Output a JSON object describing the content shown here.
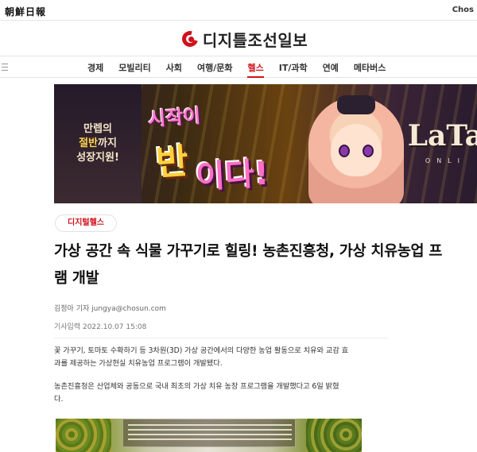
{
  "topbar": {
    "masthead": "朝鮮日報",
    "right_text": "Chos"
  },
  "logo": {
    "text": "디지틀조선일보",
    "accent": "#d1121b"
  },
  "nav": {
    "items": [
      {
        "label": "경제"
      },
      {
        "label": "모빌리티"
      },
      {
        "label": "사회"
      },
      {
        "label": "여행/문화"
      },
      {
        "label": "헬스",
        "active": true
      },
      {
        "label": "IT/과학"
      },
      {
        "label": "연예"
      },
      {
        "label": "메타버스"
      }
    ]
  },
  "banner": {
    "left_line1": "만렙의",
    "left_line2_highlight": "절반",
    "left_line2_rest": "까지",
    "left_line3": "성장지원!",
    "title_a": "시작이",
    "title_b": "반",
    "title_c": "이다!",
    "game_logo": "LaTa",
    "game_sub": "ONLI"
  },
  "article": {
    "category": "디지털헬스",
    "headline_line1": "가상 공간 속 식물 가꾸기로 힐링! 농촌진흥청, 가상 치유농업 프",
    "headline_line2": "램 개발",
    "byline": "김정아 기자 jungya@chosun.com",
    "date": "기사입력 2022.10.07 15:08",
    "paragraph1_line1": "꽃 가꾸기, 토마토 수확하기 등 3차원(3D) 가상 공간에서의 다양한 농업 활동으로 치유와 교감 효",
    "paragraph1_line2": "과를 제공하는 가상현실 치유농업 프로그램이 개발됐다.",
    "paragraph2_line1": "농촌진흥청은 산업체와 공동으로 국내 최초의 가상 치유 농장 프로그램을 개발했다고 6일 밝혔",
    "paragraph2_line2": "다."
  }
}
